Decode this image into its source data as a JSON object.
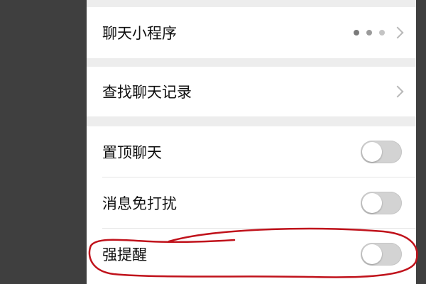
{
  "settings": {
    "mini_programs": {
      "label": "聊天小程序"
    },
    "search_history": {
      "label": "查找聊天记录"
    },
    "sticky": {
      "label": "置顶聊天",
      "enabled": false
    },
    "mute": {
      "label": "消息免打扰",
      "enabled": false
    },
    "strong_reminder": {
      "label": "强提醒",
      "enabled": false
    }
  },
  "colors": {
    "annotation": "#c0121b",
    "dot_dark": "#7a7a7a",
    "dot_mid": "#9b9b9b",
    "dot_light": "#c4c4c4"
  },
  "icons": {
    "chevron": "chevron-right-icon",
    "dots": "more-dots-icon"
  }
}
